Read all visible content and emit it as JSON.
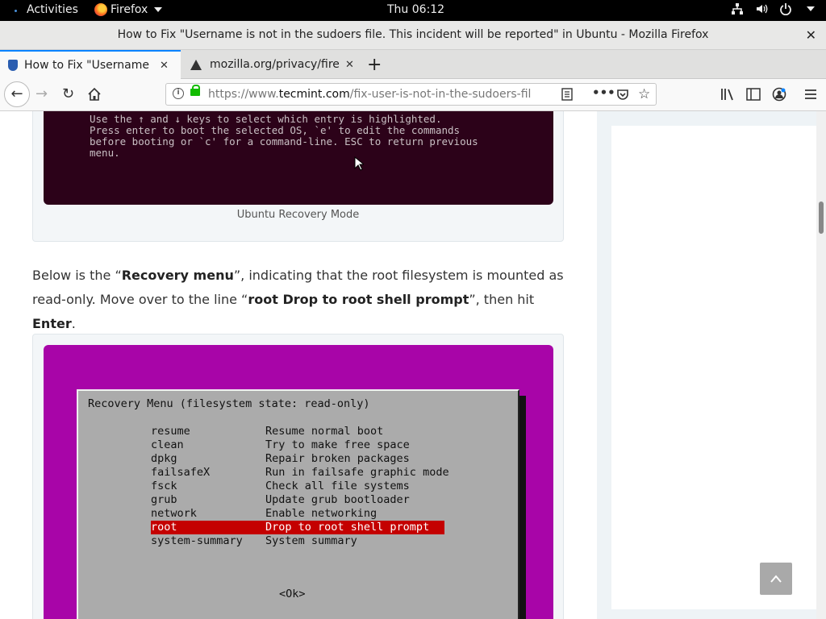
{
  "topbar": {
    "activities": "Activities",
    "app_name": "Firefox",
    "clock": "Thu 06:12"
  },
  "window": {
    "title": "How to Fix \"Username is not in the sudoers file. This incident will be reported\" in Ubuntu - Mozilla Firefox"
  },
  "tabs": [
    {
      "label": "How to Fix \"Username is not in the sudoers file"
    },
    {
      "label": "mozilla.org/privacy/firefox/"
    }
  ],
  "urlbar": {
    "prefix": "https://www.",
    "domain": "tecmint.com",
    "path": "/fix-user-is-not-in-the-sudoers-file-t"
  },
  "article": {
    "grub_text": "Use the ↑ and ↓ keys to select which entry is highlighted.\nPress enter to boot the selected OS, `e' to edit the commands\nbefore booting or `c' for a command-line. ESC to return previous\nmenu.",
    "figure1_caption": "Ubuntu Recovery Mode",
    "para_1": "Below is the “",
    "para_bold_1": "Recovery menu",
    "para_2": "”, indicating that the root filesystem is mounted as read-only. Move over to the line “",
    "para_bold_2": "root Drop to root shell prompt",
    "para_3": "”, then hit ",
    "para_bold_3": "Enter",
    "para_4": ".",
    "recovery": {
      "title": "Recovery Menu (filesystem state: read-only)",
      "rows": [
        {
          "key": "resume",
          "desc": "Resume normal boot"
        },
        {
          "key": "clean",
          "desc": "Try to make free space"
        },
        {
          "key": "dpkg",
          "desc": "Repair broken packages"
        },
        {
          "key": "failsafeX",
          "desc": "Run in failsafe graphic mode"
        },
        {
          "key": "fsck",
          "desc": "Check all file systems"
        },
        {
          "key": "grub",
          "desc": "Update grub bootloader"
        },
        {
          "key": "network",
          "desc": "Enable networking"
        },
        {
          "key": "root",
          "desc": "Drop to root shell prompt"
        },
        {
          "key": "system-summary",
          "desc": "System summary"
        }
      ],
      "selected_index": 7,
      "ok": "<Ok>"
    }
  },
  "colors": {
    "accent": "#0a84ff",
    "grub_bg": "#2c0219",
    "recovery_bg": "#a805a8",
    "selected_row": "#c40000"
  }
}
